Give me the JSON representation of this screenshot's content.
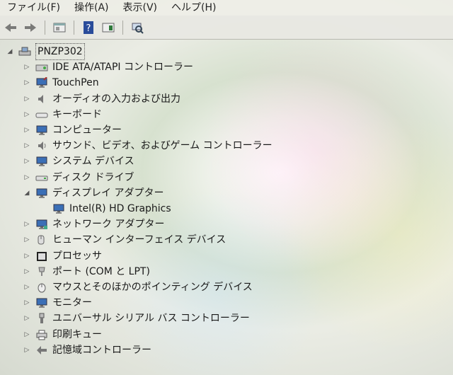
{
  "menu": [
    "ファイル(F)",
    "操作(A)",
    "表示(V)",
    "ヘルプ(H)"
  ],
  "toolbar": {
    "icons": [
      "back-icon",
      "forward-icon",
      "properties-icon",
      "help-icon",
      "view-icon",
      "scan-hardware-icon"
    ]
  },
  "tree": {
    "root": "PNZP302",
    "items": [
      {
        "label": "IDE ATA/ATAPI コントローラー",
        "icon": "ide-controller-icon",
        "expanded": false
      },
      {
        "label": "TouchPen",
        "icon": "touchpen-icon",
        "expanded": false
      },
      {
        "label": "オーディオの入力および出力",
        "icon": "audio-icon",
        "expanded": false
      },
      {
        "label": "キーボード",
        "icon": "keyboard-icon",
        "expanded": false
      },
      {
        "label": "コンピューター",
        "icon": "computer-icon",
        "expanded": false
      },
      {
        "label": "サウンド、ビデオ、およびゲーム コントローラー",
        "icon": "sound-icon",
        "expanded": false
      },
      {
        "label": "システム デバイス",
        "icon": "system-devices-icon",
        "expanded": false
      },
      {
        "label": "ディスク ドライブ",
        "icon": "disk-drive-icon",
        "expanded": false
      },
      {
        "label": "ディスプレイ アダプター",
        "icon": "display-adapter-icon",
        "expanded": true,
        "children": [
          "Intel(R) HD Graphics"
        ]
      },
      {
        "label": "ネットワーク アダプター",
        "icon": "network-adapter-icon",
        "expanded": false
      },
      {
        "label": "ヒューマン インターフェイス デバイス",
        "icon": "hid-icon",
        "expanded": false
      },
      {
        "label": "プロセッサ",
        "icon": "processor-icon",
        "expanded": false
      },
      {
        "label": "ポート (COM と LPT)",
        "icon": "port-icon",
        "expanded": false
      },
      {
        "label": "マウスとそのほかのポインティング デバイス",
        "icon": "mouse-icon",
        "expanded": false
      },
      {
        "label": "モニター",
        "icon": "monitor-icon",
        "expanded": false
      },
      {
        "label": "ユニバーサル シリアル バス コントローラー",
        "icon": "usb-icon",
        "expanded": false
      },
      {
        "label": "印刷キュー",
        "icon": "print-queue-icon",
        "expanded": false
      },
      {
        "label": "記憶域コントローラー",
        "icon": "storage-controller-icon",
        "expanded": false
      }
    ]
  }
}
